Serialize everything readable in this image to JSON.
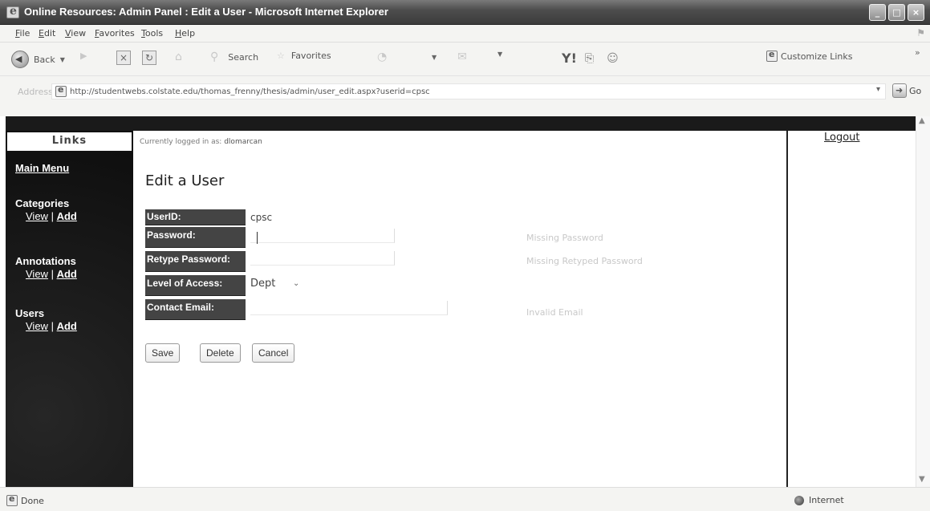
{
  "window": {
    "title": "Online Resources: Admin Panel : Edit a User - Microsoft Internet Explorer",
    "controls": [
      "_",
      "□",
      "×"
    ]
  },
  "menu": [
    "File",
    "Edit",
    "View",
    "Favorites",
    "Tools",
    "Help"
  ],
  "toolbar": {
    "back": "Back",
    "search": "Search",
    "favorites": "Favorites",
    "customize_links": "Customize Links"
  },
  "address": {
    "label": "Address",
    "url": "http://studentwebs.colstate.edu/thomas_frenny/thesis/admin/user_edit.aspx?userid=cpsc",
    "go": "Go"
  },
  "sidebar": {
    "title": "Links",
    "main_menu": "Main Menu",
    "sections": [
      {
        "name": "Categories",
        "view": "View",
        "sep": "|",
        "add": "Add"
      },
      {
        "name": "Annotations",
        "view": "View",
        "sep": "|",
        "add": "Add"
      },
      {
        "name": "Users",
        "view": "View",
        "sep": "|",
        "add": "Add"
      }
    ]
  },
  "main": {
    "logged_in_prefix": "Currently logged in as:",
    "logged_in_user": "dlomarcan",
    "heading": "Edit a User",
    "fields": {
      "userid_label": "UserID:",
      "userid_value": "cpsc",
      "password_label": "Password:",
      "retype_label": "Retype Password:",
      "access_label": "Level of Access:",
      "access_value": "Dept",
      "email_label": "Contact Email:"
    },
    "errors": {
      "password": "Missing Password",
      "retype": "Missing Retyped Password",
      "email": "Invalid Email"
    },
    "buttons": {
      "save": "Save",
      "delete": "Delete",
      "cancel": "Cancel"
    }
  },
  "right": {
    "logout": "Logout"
  },
  "status": {
    "left": "Done",
    "zone": "Internet"
  }
}
